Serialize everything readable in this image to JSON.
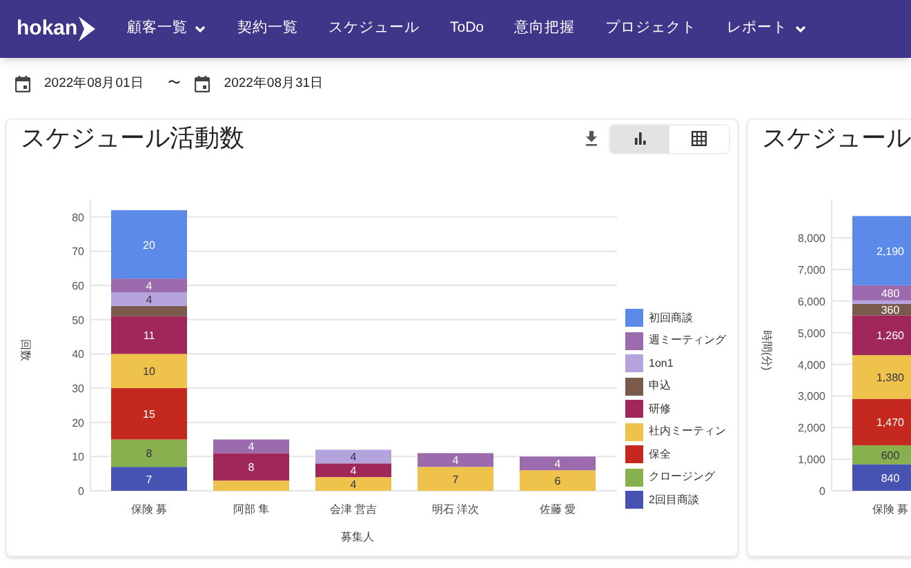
{
  "nav": {
    "logo": "hokan",
    "items": [
      {
        "label": "顧客一覧",
        "dropdown": true
      },
      {
        "label": "契約一覧",
        "dropdown": false
      },
      {
        "label": "スケジュール",
        "dropdown": false
      },
      {
        "label": "ToDo",
        "dropdown": false
      },
      {
        "label": "意向把握",
        "dropdown": false
      },
      {
        "label": "プロジェクト",
        "dropdown": false
      },
      {
        "label": "レポート",
        "dropdown": true
      }
    ]
  },
  "date_range": {
    "start": "2022年08月01日",
    "separator": "〜",
    "end": "2022年08月31日"
  },
  "panels": [
    {
      "title": "スケジュール活動数",
      "toolbar": true,
      "view_toggle": [
        {
          "kind": "chart",
          "selected": true
        },
        {
          "kind": "table",
          "selected": false
        }
      ],
      "legend": true,
      "chart_data": {
        "type": "bar",
        "stacked": true,
        "orientation": "vertical",
        "grid": true,
        "xlabel": "募集人",
        "ylabel": "回数",
        "categories": [
          "保険 募",
          "阿部 隼",
          "会津 営吉",
          "明石 洋次",
          "佐藤 愛"
        ],
        "ylim": [
          0,
          85
        ],
        "yticks": [
          0,
          10,
          20,
          30,
          40,
          50,
          60,
          70,
          80
        ],
        "series": [
          {
            "name": "2回目商談",
            "color": "#4653b2",
            "values": [
              7,
              null,
              null,
              null,
              null
            ],
            "value_labels": [
              "7",
              null,
              null,
              null,
              null
            ]
          },
          {
            "name": "クロージング",
            "color": "#88b04f",
            "values": [
              8,
              null,
              null,
              null,
              null
            ],
            "value_labels": [
              "8",
              null,
              null,
              null,
              null
            ]
          },
          {
            "name": "保全",
            "color": "#c4281f",
            "values": [
              15,
              null,
              null,
              null,
              null
            ],
            "value_labels": [
              "15",
              null,
              null,
              null,
              null
            ]
          },
          {
            "name": "社内ミーティン",
            "color": "#efc24b",
            "values": [
              10,
              3,
              4,
              7,
              6
            ],
            "value_labels": [
              "10",
              null,
              "4",
              "7",
              "6"
            ]
          },
          {
            "name": "研修",
            "color": "#a0275a",
            "values": [
              11,
              8,
              4,
              null,
              null
            ],
            "value_labels": [
              "11",
              "8",
              "4",
              null,
              null
            ]
          },
          {
            "name": "申込",
            "color": "#7a5a4d",
            "values": [
              3,
              null,
              null,
              null,
              null
            ],
            "value_labels": [
              null,
              null,
              null,
              null,
              null
            ]
          },
          {
            "name": "1on1",
            "color": "#b4a3dc",
            "values": [
              4,
              null,
              4,
              null,
              null
            ],
            "value_labels": [
              "4",
              null,
              "4",
              null,
              null
            ]
          },
          {
            "name": "週ミーティング",
            "color": "#9b6bad",
            "values": [
              4,
              4,
              null,
              4,
              4
            ],
            "value_labels": [
              "4",
              "4",
              null,
              "4",
              "4"
            ]
          },
          {
            "name": "初回商談",
            "color": "#5b8ae8",
            "values": [
              20,
              null,
              null,
              null,
              null
            ],
            "value_labels": [
              "20",
              null,
              null,
              null,
              null
            ]
          }
        ]
      }
    },
    {
      "title": "スケジュール",
      "chart_data": {
        "type": "bar",
        "stacked": true,
        "orientation": "vertical",
        "grid": true,
        "ylabel": "時間(分)",
        "categories": [
          "保険 募"
        ],
        "ylim": [
          0,
          9200
        ],
        "yticks": [
          {
            "value": 0,
            "label": "0"
          },
          {
            "value": 1000,
            "label": "1,000"
          },
          {
            "value": 2000,
            "label": "2,000"
          },
          {
            "value": 3000,
            "label": "3,000"
          },
          {
            "value": 4000,
            "label": "4,000"
          },
          {
            "value": 5000,
            "label": "5,000"
          },
          {
            "value": 6000,
            "label": "6,000"
          },
          {
            "value": 7000,
            "label": "7,000"
          },
          {
            "value": 8000,
            "label": "8,000"
          }
        ],
        "series": [
          {
            "color": "#4653b2",
            "values": [
              840
            ],
            "value_labels": [
              "840"
            ]
          },
          {
            "color": "#88b04f",
            "values": [
              600
            ],
            "value_labels": [
              "600"
            ]
          },
          {
            "color": "#c4281f",
            "values": [
              1470
            ],
            "value_labels": [
              "1,470"
            ]
          },
          {
            "color": "#efc24b",
            "values": [
              1380
            ],
            "value_labels": [
              "1,380"
            ]
          },
          {
            "color": "#a0275a",
            "values": [
              1260
            ],
            "value_labels": [
              "1,260"
            ]
          },
          {
            "color": "#7a5a4d",
            "values": [
              360
            ],
            "value_labels": [
              "360"
            ]
          },
          {
            "color": "#b4a3dc",
            "values": [
              110
            ],
            "value_labels": [
              null
            ]
          },
          {
            "color": "#9b6bad",
            "values": [
              480
            ],
            "value_labels": [
              "480"
            ]
          },
          {
            "color": "#5b8ae8",
            "values": [
              2190
            ],
            "value_labels": [
              "2,190"
            ]
          }
        ]
      }
    }
  ]
}
